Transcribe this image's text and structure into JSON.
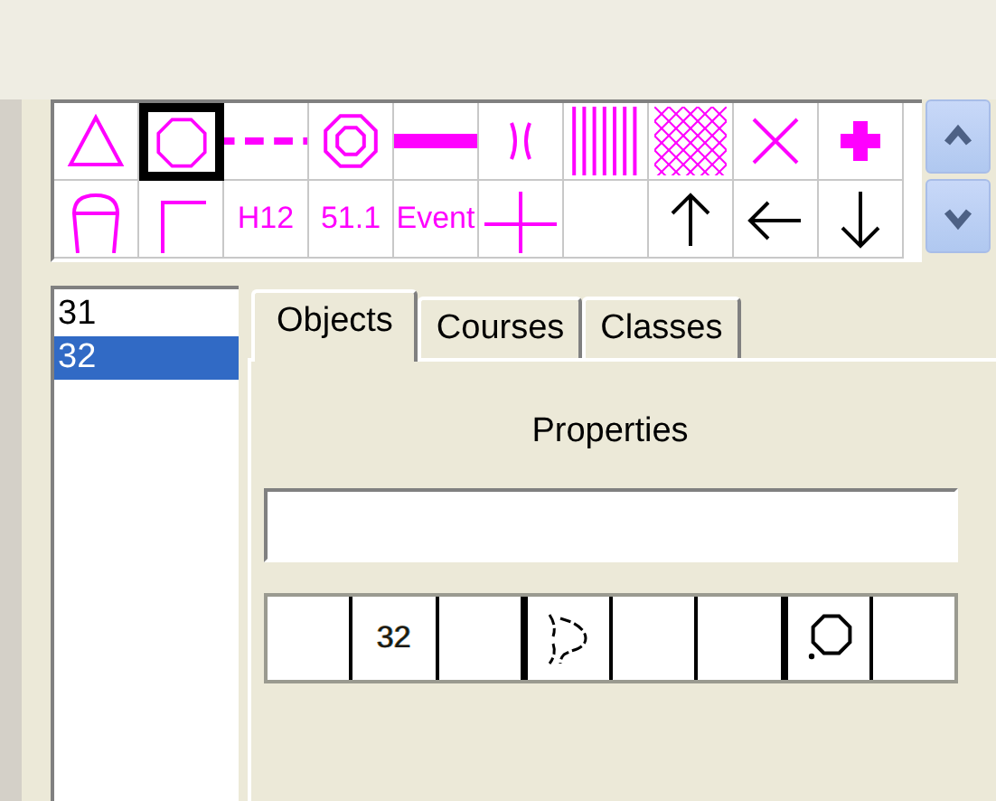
{
  "palette": {
    "cells": [
      {
        "kind": "triangle",
        "selected": false
      },
      {
        "kind": "octagon",
        "selected": true
      },
      {
        "kind": "dashed",
        "selected": false
      },
      {
        "kind": "rings",
        "selected": false
      },
      {
        "kind": "bar",
        "selected": false
      },
      {
        "kind": "bracket",
        "selected": false
      },
      {
        "kind": "stripes",
        "selected": false
      },
      {
        "kind": "hatch",
        "selected": false
      },
      {
        "kind": "cross",
        "selected": false
      },
      {
        "kind": "plus",
        "selected": false
      },
      {
        "kind": "cup",
        "selected": false
      },
      {
        "kind": "corner",
        "selected": false
      },
      {
        "kind": "text",
        "label": "H12",
        "selected": false
      },
      {
        "kind": "text",
        "label": "51.1",
        "selected": false
      },
      {
        "kind": "text",
        "label": "Event",
        "selected": false
      },
      {
        "kind": "crosshair",
        "selected": false
      },
      {
        "kind": "empty",
        "selected": false
      },
      {
        "kind": "up",
        "selected": false
      },
      {
        "kind": "left",
        "selected": false
      },
      {
        "kind": "down",
        "selected": false
      }
    ]
  },
  "list": {
    "items": [
      {
        "label": "31",
        "selected": false
      },
      {
        "label": "32",
        "selected": true
      }
    ]
  },
  "tabs": [
    {
      "label": "Objects",
      "selected": true
    },
    {
      "label": "Courses",
      "selected": false
    },
    {
      "label": "Classes",
      "selected": false
    }
  ],
  "properties": {
    "heading": "Properties",
    "strip": [
      {
        "kind": "empty",
        "divider": false
      },
      {
        "kind": "text",
        "label": "32",
        "divider": false
      },
      {
        "kind": "empty",
        "divider": false
      },
      {
        "kind": "gate",
        "divider": true
      },
      {
        "kind": "empty",
        "divider": false
      },
      {
        "kind": "empty",
        "divider": false
      },
      {
        "kind": "ring",
        "divider": true
      },
      {
        "kind": "empty",
        "divider": false
      }
    ]
  }
}
